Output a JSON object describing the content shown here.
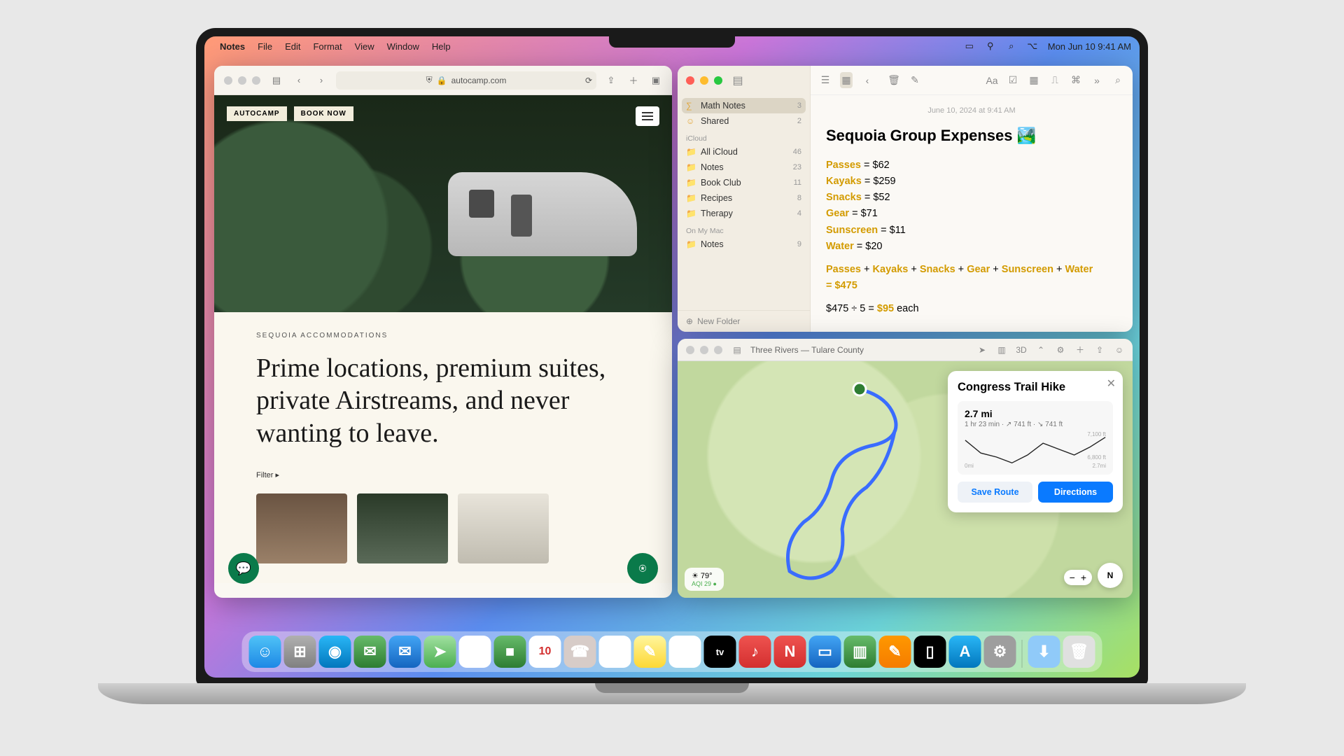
{
  "menubar": {
    "app": "Notes",
    "items": [
      "File",
      "Edit",
      "Format",
      "View",
      "Window",
      "Help"
    ],
    "datetime": "Mon Jun 10  9:41 AM"
  },
  "safari": {
    "url_host": "autocamp.com",
    "brand": "AUTOCAMP",
    "book": "BOOK NOW",
    "eyebrow": "SEQUOIA ACCOMMODATIONS",
    "headline": "Prime locations, premium suites, private Airstreams, and never wanting to leave.",
    "filter": "Filter ▸"
  },
  "notes": {
    "quick": [
      {
        "name": "Math Notes",
        "count": "3",
        "selected": true,
        "icon": "∑"
      },
      {
        "name": "Shared",
        "count": "2",
        "icon": "☺"
      }
    ],
    "icloud_label": "iCloud",
    "icloud": [
      {
        "name": "All iCloud",
        "count": "46"
      },
      {
        "name": "Notes",
        "count": "23"
      },
      {
        "name": "Book Club",
        "count": "11"
      },
      {
        "name": "Recipes",
        "count": "8"
      },
      {
        "name": "Therapy",
        "count": "4"
      }
    ],
    "onmac_label": "On My Mac",
    "onmac": [
      {
        "name": "Notes",
        "count": "9"
      }
    ],
    "new_folder": "New Folder",
    "note": {
      "date": "June 10, 2024 at 9:41 AM",
      "title": "Sequoia Group Expenses 🏞️",
      "lines": [
        {
          "k": "Passes",
          "v": " = $62"
        },
        {
          "k": "Kayaks",
          "v": " = $259"
        },
        {
          "k": "Snacks",
          "v": " = $52"
        },
        {
          "k": "Gear",
          "v": " = $71"
        },
        {
          "k": "Sunscreen",
          "v": " = $11"
        },
        {
          "k": "Water",
          "v": " = $20"
        }
      ],
      "sum_parts": [
        "Passes",
        " + ",
        "Kayaks",
        " + ",
        "Snacks",
        " + ",
        "Gear",
        " + ",
        "Sunscreen",
        " + ",
        "Water"
      ],
      "sum_result": "= $475",
      "divide_left": "$475 ÷ 5  =  ",
      "divide_result": "$95",
      "divide_suffix": " each"
    }
  },
  "maps": {
    "title": "Three Rivers — Tulare County",
    "card": {
      "title": "Congress Trail Hike",
      "distance": "2.7 mi",
      "duration": "1 hr 23 min",
      "ascent": "↗ 741 ft",
      "descent": "↘ 741 ft",
      "elev_high": "7,100 ft",
      "elev_low": "6,800 ft",
      "x0": "0mi",
      "x1": "2.7mi",
      "save": "Save Route",
      "directions": "Directions"
    },
    "weather": {
      "temp": "79°",
      "aqi": "AQI 29 ●"
    },
    "compass": "N"
  },
  "chart_data": {
    "type": "line",
    "title": "Congress Trail Hike elevation",
    "xlabel": "mi",
    "ylabel": "ft",
    "x": [
      0,
      0.3,
      0.6,
      0.9,
      1.2,
      1.5,
      1.8,
      2.1,
      2.4,
      2.7
    ],
    "values": [
      7050,
      6920,
      6880,
      6820,
      6900,
      7020,
      6960,
      6900,
      6980,
      7080
    ],
    "ylim": [
      6800,
      7100
    ],
    "xlim": [
      0,
      2.7
    ]
  },
  "dock": [
    {
      "name": "finder",
      "bg": "linear-gradient(#4fc3f7,#1e88e5)",
      "glyph": "☺"
    },
    {
      "name": "launchpad",
      "bg": "linear-gradient(#b0b0b0,#808080)",
      "glyph": "⊞"
    },
    {
      "name": "safari",
      "bg": "linear-gradient(#29b6f6,#0277bd)",
      "glyph": "◉"
    },
    {
      "name": "messages",
      "bg": "linear-gradient(#66bb6a,#2e7d32)",
      "glyph": "✉"
    },
    {
      "name": "mail",
      "bg": "linear-gradient(#42a5f5,#1565c0)",
      "glyph": "✉"
    },
    {
      "name": "maps",
      "bg": "linear-gradient(#a0e0a0,#4caf50)",
      "glyph": "➤"
    },
    {
      "name": "photos",
      "bg": "#fff",
      "glyph": "✿"
    },
    {
      "name": "facetime",
      "bg": "linear-gradient(#66bb6a,#2e7d32)",
      "glyph": "■"
    },
    {
      "name": "calendar",
      "bg": "#fff",
      "glyph": "10"
    },
    {
      "name": "contacts",
      "bg": "#d7ccc8",
      "glyph": "☎"
    },
    {
      "name": "reminders",
      "bg": "#fff",
      "glyph": "☰"
    },
    {
      "name": "notes",
      "bg": "linear-gradient(#fff59d,#fdd835)",
      "glyph": "✎"
    },
    {
      "name": "freeform",
      "bg": "#fff",
      "glyph": "〰"
    },
    {
      "name": "tv",
      "bg": "#000",
      "glyph": "tv"
    },
    {
      "name": "music",
      "bg": "linear-gradient(#ef5350,#d32f2f)",
      "glyph": "♪"
    },
    {
      "name": "news",
      "bg": "linear-gradient(#ef5350,#d32f2f)",
      "glyph": "N"
    },
    {
      "name": "keynote",
      "bg": "linear-gradient(#42a5f5,#1565c0)",
      "glyph": "▭"
    },
    {
      "name": "numbers",
      "bg": "linear-gradient(#66bb6a,#2e7d32)",
      "glyph": "▥"
    },
    {
      "name": "pages",
      "bg": "linear-gradient(#ff9800,#f57c00)",
      "glyph": "✎"
    },
    {
      "name": "iphone-mirror",
      "bg": "#000",
      "glyph": "▯"
    },
    {
      "name": "appstore",
      "bg": "linear-gradient(#29b6f6,#0277bd)",
      "glyph": "A"
    },
    {
      "name": "settings",
      "bg": "#9e9e9e",
      "glyph": "⚙"
    }
  ],
  "dock_right": [
    {
      "name": "downloads",
      "bg": "#90caf9",
      "glyph": "⬇"
    },
    {
      "name": "trash",
      "bg": "#e0e0e0",
      "glyph": "🗑"
    }
  ]
}
